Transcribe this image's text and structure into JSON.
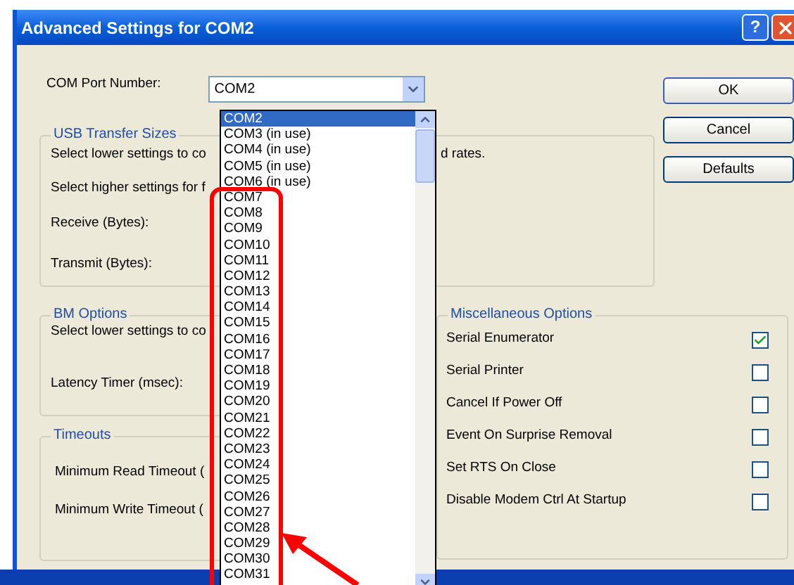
{
  "window": {
    "title": "Advanced Settings for COM2",
    "help_button": "?"
  },
  "com_port": {
    "label": "COM Port Number:",
    "value": "COM2",
    "options": [
      {
        "label": "COM2",
        "selected": true
      },
      {
        "label": "COM3 (in use)",
        "selected": false
      },
      {
        "label": "COM4 (in use)",
        "selected": false
      },
      {
        "label": "COM5 (in use)",
        "selected": false
      },
      {
        "label": "COM6 (in use)",
        "selected": false
      },
      {
        "label": "COM7",
        "selected": false
      },
      {
        "label": "COM8",
        "selected": false
      },
      {
        "label": "COM9",
        "selected": false
      },
      {
        "label": "COM10",
        "selected": false
      },
      {
        "label": "COM11",
        "selected": false
      },
      {
        "label": "COM12",
        "selected": false
      },
      {
        "label": "COM13",
        "selected": false
      },
      {
        "label": "COM14",
        "selected": false
      },
      {
        "label": "COM15",
        "selected": false
      },
      {
        "label": "COM16",
        "selected": false
      },
      {
        "label": "COM17",
        "selected": false
      },
      {
        "label": "COM18",
        "selected": false
      },
      {
        "label": "COM19",
        "selected": false
      },
      {
        "label": "COM20",
        "selected": false
      },
      {
        "label": "COM21",
        "selected": false
      },
      {
        "label": "COM22",
        "selected": false
      },
      {
        "label": "COM23",
        "selected": false
      },
      {
        "label": "COM24",
        "selected": false
      },
      {
        "label": "COM25",
        "selected": false
      },
      {
        "label": "COM26",
        "selected": false
      },
      {
        "label": "COM27",
        "selected": false
      },
      {
        "label": "COM28",
        "selected": false
      },
      {
        "label": "COM29",
        "selected": false
      },
      {
        "label": "COM30",
        "selected": false
      },
      {
        "label": "COM31",
        "selected": false
      }
    ]
  },
  "usb_transfer_sizes": {
    "title": "USB Transfer Sizes",
    "lower_text": "Select lower settings to co",
    "lower_text_end": "d rates.",
    "higher_text": "Select higher settings for f",
    "receive_label": "Receive (Bytes):",
    "transmit_label": "Transmit (Bytes):"
  },
  "buttons": [
    "OK",
    "Cancel",
    "Defaults"
  ],
  "bm_options": {
    "title": "BM Options",
    "text": "Select lower settings to co",
    "latency_label": "Latency Timer (msec):"
  },
  "timeouts": {
    "title": "Timeouts",
    "read_label": "Minimum Read Timeout (",
    "write_label": "Minimum Write Timeout ("
  },
  "miscellaneous_options": {
    "title": "Miscellaneous Options",
    "items": [
      {
        "label": "Serial Enumerator",
        "checked": true
      },
      {
        "label": "Serial Printer",
        "checked": false
      },
      {
        "label": "Cancel If Power Off",
        "checked": false
      },
      {
        "label": "Event On Surprise Removal",
        "checked": false
      },
      {
        "label": "Set RTS On Close",
        "checked": false
      },
      {
        "label": "Disable Modem Ctrl At Startup",
        "checked": false
      }
    ]
  }
}
